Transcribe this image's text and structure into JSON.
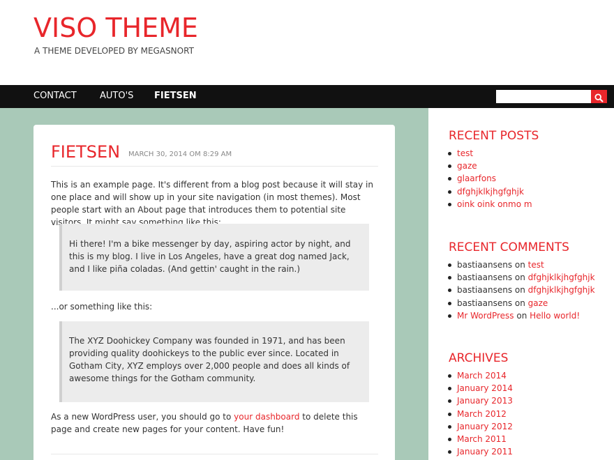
{
  "site": {
    "title": "VISO THEME",
    "description": "A THEME DEVELOPED BY MEGASNORT",
    "accent_color": "#e8262b",
    "main_bg_color": "#a9c9b8"
  },
  "nav": {
    "items": [
      {
        "label": "CONTACT"
      },
      {
        "label": "AUTO'S"
      },
      {
        "label": "FIETSEN",
        "active": true
      }
    ],
    "search": {
      "placeholder": "",
      "value": "",
      "button_icon": "search-icon"
    }
  },
  "page": {
    "title": "FIETSEN",
    "date": "MARCH 30, 2014 OM 8:29 AM",
    "intro": "This is an example page. It's different from a blog post because it will stay in one place and will show up in your site navigation (in most themes). Most people start with an About page that introduces them to potential site visitors. It might say something like this:",
    "quote1": "Hi there! I'm a bike messenger by day, aspiring actor by night, and this is my blog. I live in Los Angeles, have a great dog named Jack, and I like piña coladas. (And gettin' caught in the rain.)",
    "middle": "...or something like this:",
    "quote2": "The XYZ Doohickey Company was founded in 1971, and has been providing quality doohickeys to the public ever since. Located in Gotham City, XYZ employs over 2,000 people and does all kinds of awesome things for the Gotham community.",
    "outro_before": "As a new WordPress user, you should go to ",
    "outro_link": "your dashboard",
    "outro_after": " to delete this page and create new pages for your content. Have fun!"
  },
  "sidebar": {
    "recent_posts": {
      "title": "RECENT POSTS",
      "items": [
        "test",
        "gaze",
        "glaarfons",
        "dfghjklkjhgfghjk",
        "oink oink onmo m"
      ]
    },
    "recent_comments": {
      "title": "RECENT COMMENTS",
      "items": [
        {
          "author": "bastiaansens",
          "on": " on ",
          "post": "test"
        },
        {
          "author": "bastiaansens",
          "on": " on ",
          "post": "dfghjklkjhgfghjk"
        },
        {
          "author": "bastiaansens",
          "on": " on ",
          "post": "dfghjklkjhgfghjk"
        },
        {
          "author": "bastiaansens",
          "on": " on ",
          "post": "gaze"
        },
        {
          "author": "Mr WordPress",
          "on": " on ",
          "post": "Hello world!",
          "author_link": true
        }
      ]
    },
    "archives": {
      "title": "ARCHIVES",
      "items": [
        "March 2014",
        "January 2014",
        "January 2013",
        "March 2012",
        "January 2012",
        "March 2011",
        "January 2011"
      ]
    }
  }
}
